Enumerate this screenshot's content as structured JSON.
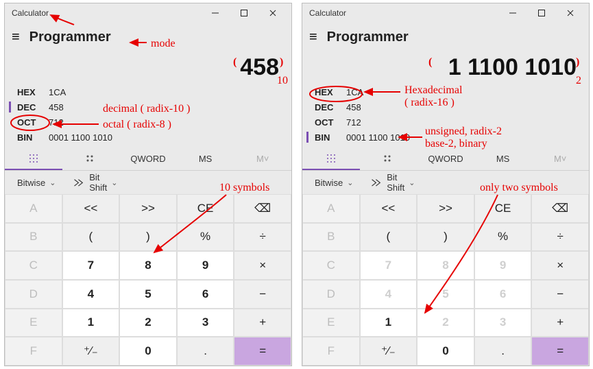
{
  "left": {
    "window_title": "Calculator",
    "mode": "Programmer",
    "display": "458",
    "radix": {
      "hex": {
        "label": "HEX",
        "value": "1CA"
      },
      "dec": {
        "label": "DEC",
        "value": "458"
      },
      "oct": {
        "label": "OCT",
        "value": "712"
      },
      "bin": {
        "label": "BIN",
        "value": "0001 1100 1010"
      }
    },
    "active_radix": "dec",
    "tools": {
      "qword": "QWORD",
      "ms": "MS",
      "mmenu": "M˅"
    },
    "bitops": {
      "bitwise": "Bitwise",
      "bitshift": "Bit Shift"
    },
    "keys": {
      "A": "A",
      "lsh": "<<",
      "rsh": ">>",
      "CE": "CE",
      "back": "⌫",
      "B": "B",
      "lp": "(",
      "rp": ")",
      "pct": "%",
      "div": "÷",
      "C": "C",
      "7": "7",
      "8": "8",
      "9": "9",
      "mul": "×",
      "D": "D",
      "4": "4",
      "5": "5",
      "6": "6",
      "sub": "−",
      "E": "E",
      "1": "1",
      "2": "2",
      "3": "3",
      "add": "+",
      "F": "F",
      "sign": "⁺∕₋",
      "0": "0",
      "dot": ".",
      "eq": "="
    },
    "annotations": {
      "mode": "mode",
      "dec": "decimal ( radix-10 )",
      "oct": "octal ( radix-8 )",
      "symbols": "10 symbols",
      "base": "10"
    }
  },
  "right": {
    "window_title": "Calculator",
    "mode": "Programmer",
    "display": "1 1100 1010",
    "radix": {
      "hex": {
        "label": "HEX",
        "value": "1CA"
      },
      "dec": {
        "label": "DEC",
        "value": "458"
      },
      "oct": {
        "label": "OCT",
        "value": "712"
      },
      "bin": {
        "label": "BIN",
        "value": "0001 1100 1010"
      }
    },
    "active_radix": "bin",
    "tools": {
      "qword": "QWORD",
      "ms": "MS",
      "mmenu": "M˅"
    },
    "bitops": {
      "bitwise": "Bitwise",
      "bitshift": "Bit Shift"
    },
    "keys": {
      "A": "A",
      "lsh": "<<",
      "rsh": ">>",
      "CE": "CE",
      "back": "⌫",
      "B": "B",
      "lp": "(",
      "rp": ")",
      "pct": "%",
      "div": "÷",
      "C": "C",
      "7": "7",
      "8": "8",
      "9": "9",
      "mul": "×",
      "D": "D",
      "4": "4",
      "5": "5",
      "6": "6",
      "sub": "−",
      "E": "E",
      "1": "1",
      "2": "2",
      "3": "3",
      "add": "+",
      "F": "F",
      "sign": "⁺∕₋",
      "0": "0",
      "dot": ".",
      "eq": "="
    },
    "annotations": {
      "hex": "Hexadecimal",
      "hex2": "( radix-16 )",
      "bin": "unsigned, radix-2",
      "bin2": "base-2, binary",
      "symbols": "only two symbols",
      "base": "2"
    }
  }
}
